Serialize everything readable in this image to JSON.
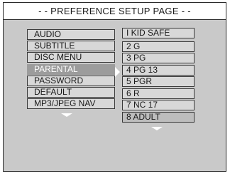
{
  "header": {
    "title": "- - PREFERENCE SETUP PAGE - -"
  },
  "menu": {
    "items": [
      {
        "label": "AUDIO"
      },
      {
        "label": "SUBTITLE"
      },
      {
        "label": "DISC MENU"
      },
      {
        "label": "PARENTAL",
        "selected": true
      },
      {
        "label": "PASSWORD"
      },
      {
        "label": "DEFAULT"
      },
      {
        "label": "MP3/JPEG NAV"
      }
    ],
    "more_icon": "triangle-down-icon"
  },
  "submenu": {
    "arrow_icon": "triangle-right-icon",
    "options": [
      {
        "label": "I KID SAFE"
      },
      {
        "label": "2 G"
      },
      {
        "label": "3 PG"
      },
      {
        "label": "4 PG 13"
      },
      {
        "label": "5 PGR"
      },
      {
        "label": "6 R"
      },
      {
        "label": "7 NC 17"
      },
      {
        "label": "8 ADULT",
        "selected": true
      }
    ],
    "more_icon": "triangle-down-icon"
  },
  "colors": {
    "background": "#c9c9c9",
    "header_background": "#ffffff",
    "item_background": "#d8d8d8",
    "selected_item_background": "#9c9c9c",
    "selected_option_background": "#bdbdbd",
    "border": "#2a2a2a",
    "arrow": "#ffffff"
  }
}
